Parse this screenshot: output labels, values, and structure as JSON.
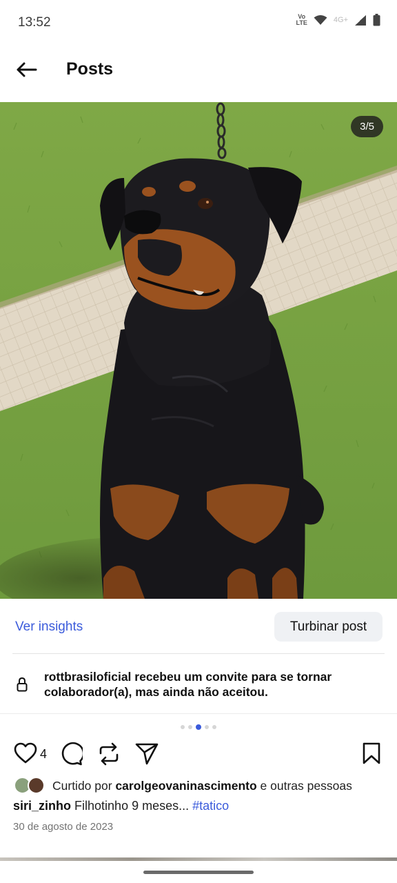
{
  "status_bar": {
    "time": "13:52",
    "volte_top": "Vo",
    "volte_bottom": "LTE",
    "network": "4G+",
    "icons": [
      "volte-icon",
      "wifi-icon",
      "signal-icon",
      "battery-icon"
    ]
  },
  "header": {
    "title": "Posts",
    "back_icon": "arrow-left-icon"
  },
  "media": {
    "counter": "3/5",
    "description_icon": "rottweiler-photo",
    "carousel_active_index": 2,
    "carousel_total": 5
  },
  "insights": {
    "link_label": "Ver insights",
    "boost_label": "Turbinar post"
  },
  "collab_notice": {
    "icon": "lock-icon",
    "text": "rottbrasiloficial recebeu um convite para se tornar colaborador(a), mas ainda não aceitou."
  },
  "actions": {
    "like_count": "4",
    "icons": [
      "heart-icon",
      "comment-icon",
      "repost-icon",
      "share-icon",
      "bookmark-icon"
    ]
  },
  "likes": {
    "prefix": "Curtido por",
    "user": "carolgeovaninascimento",
    "suffix": "e outras pessoas"
  },
  "caption": {
    "user": "siri_zinho",
    "text": "Filhotinho 9 meses...",
    "hashtag": "#tatico"
  },
  "date": "30 de agosto de 2023",
  "colors": {
    "accent": "#3b5bdb",
    "text": "#111111",
    "muted": "#737373",
    "button_bg": "#eff1f4"
  }
}
